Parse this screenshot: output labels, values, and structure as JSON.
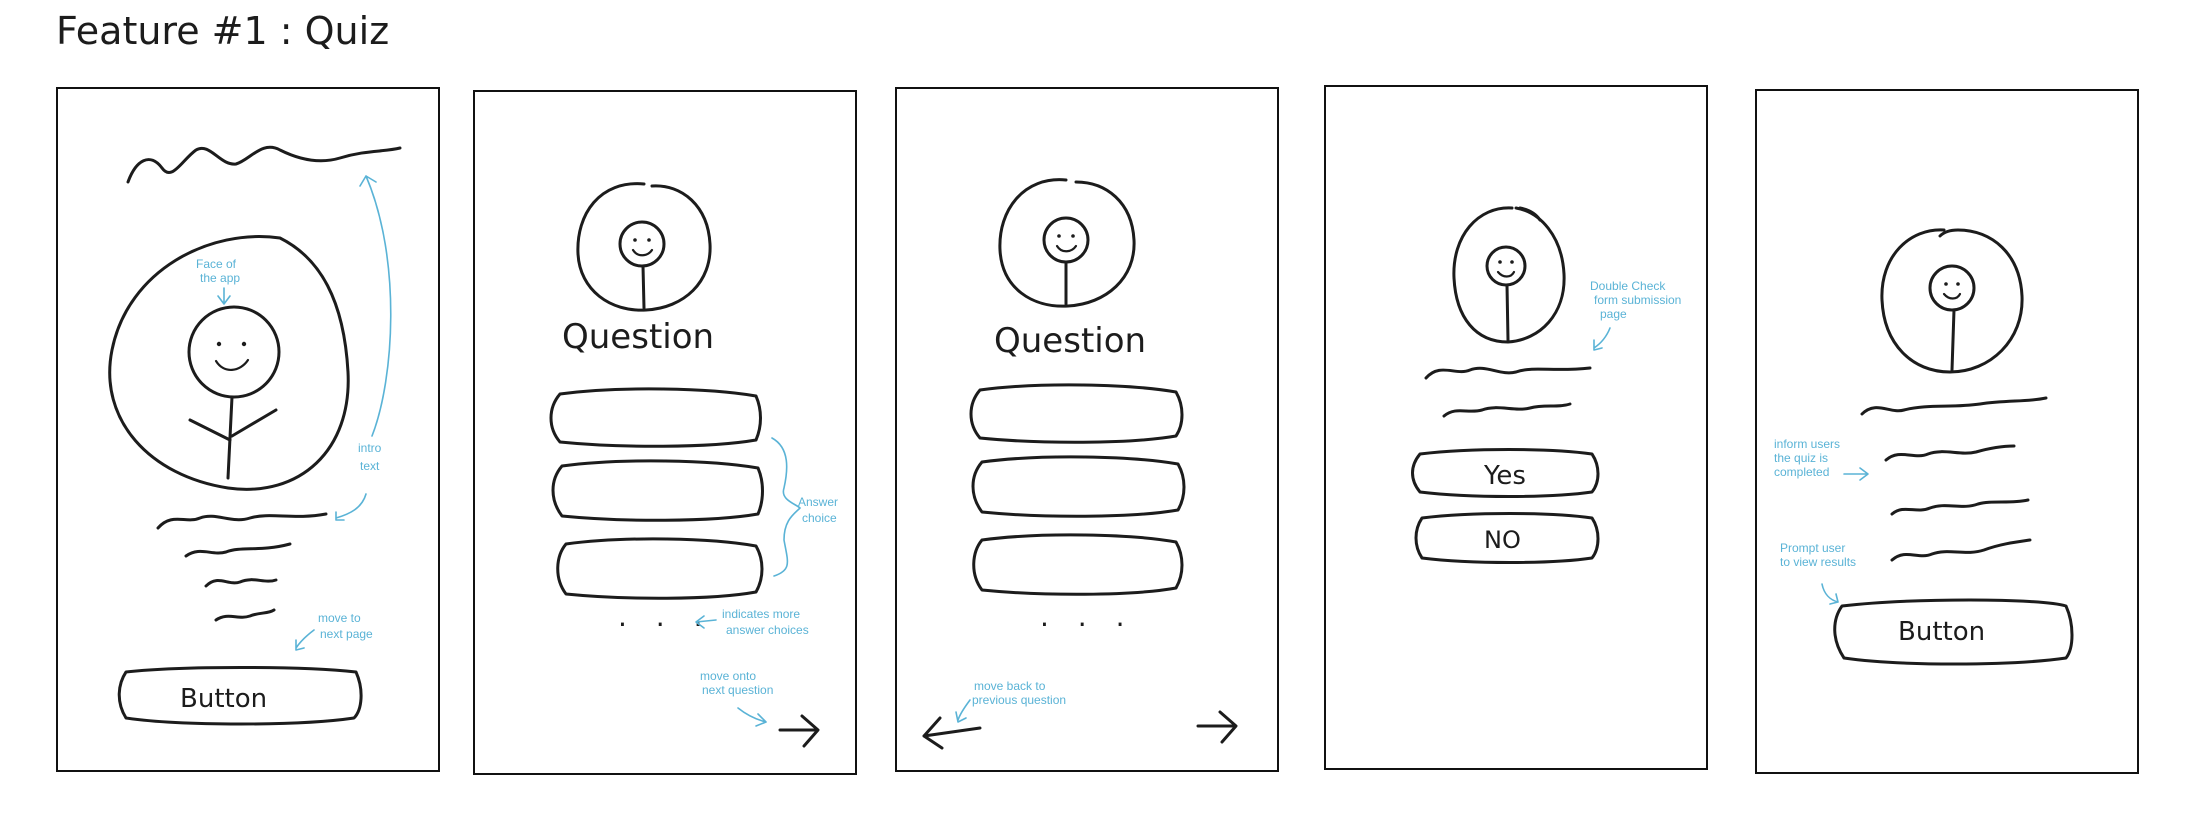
{
  "title": "Feature #1 : Quiz",
  "colors": {
    "ink": "#1c1c1c",
    "annotation": "#5ab3d6",
    "background": "#ffffff"
  },
  "frames": [
    {
      "id": "intro",
      "button_label": "Button",
      "annotations": {
        "face": [
          "Face of",
          "the app"
        ],
        "intro": [
          "intro",
          "text"
        ],
        "next": [
          "move to",
          "next page"
        ]
      }
    },
    {
      "id": "question",
      "heading": "Question",
      "ellipsis": ". . .",
      "annotations": {
        "answer": [
          "Answer",
          "choice"
        ],
        "more": [
          "indicates more",
          "answer choices"
        ],
        "next": [
          "move onto",
          "next question"
        ]
      },
      "icons": [
        "stick-figure-icon",
        "right-arrow-icon"
      ]
    },
    {
      "id": "question-back",
      "heading": "Question",
      "ellipsis": ". . .",
      "annotations": {
        "back": [
          "move back to",
          "previous question"
        ]
      },
      "icons": [
        "stick-figure-icon",
        "left-arrow-icon",
        "right-arrow-icon"
      ]
    },
    {
      "id": "confirm",
      "yes_label": "Yes",
      "no_label": "NO",
      "annotations": {
        "check": [
          "Double Check",
          "form submission",
          "page"
        ]
      }
    },
    {
      "id": "complete",
      "button_label": "Button",
      "annotations": {
        "inform": [
          "inform users",
          "the quiz is",
          "completed"
        ],
        "prompt": [
          "Prompt user",
          "to view results"
        ]
      }
    }
  ]
}
